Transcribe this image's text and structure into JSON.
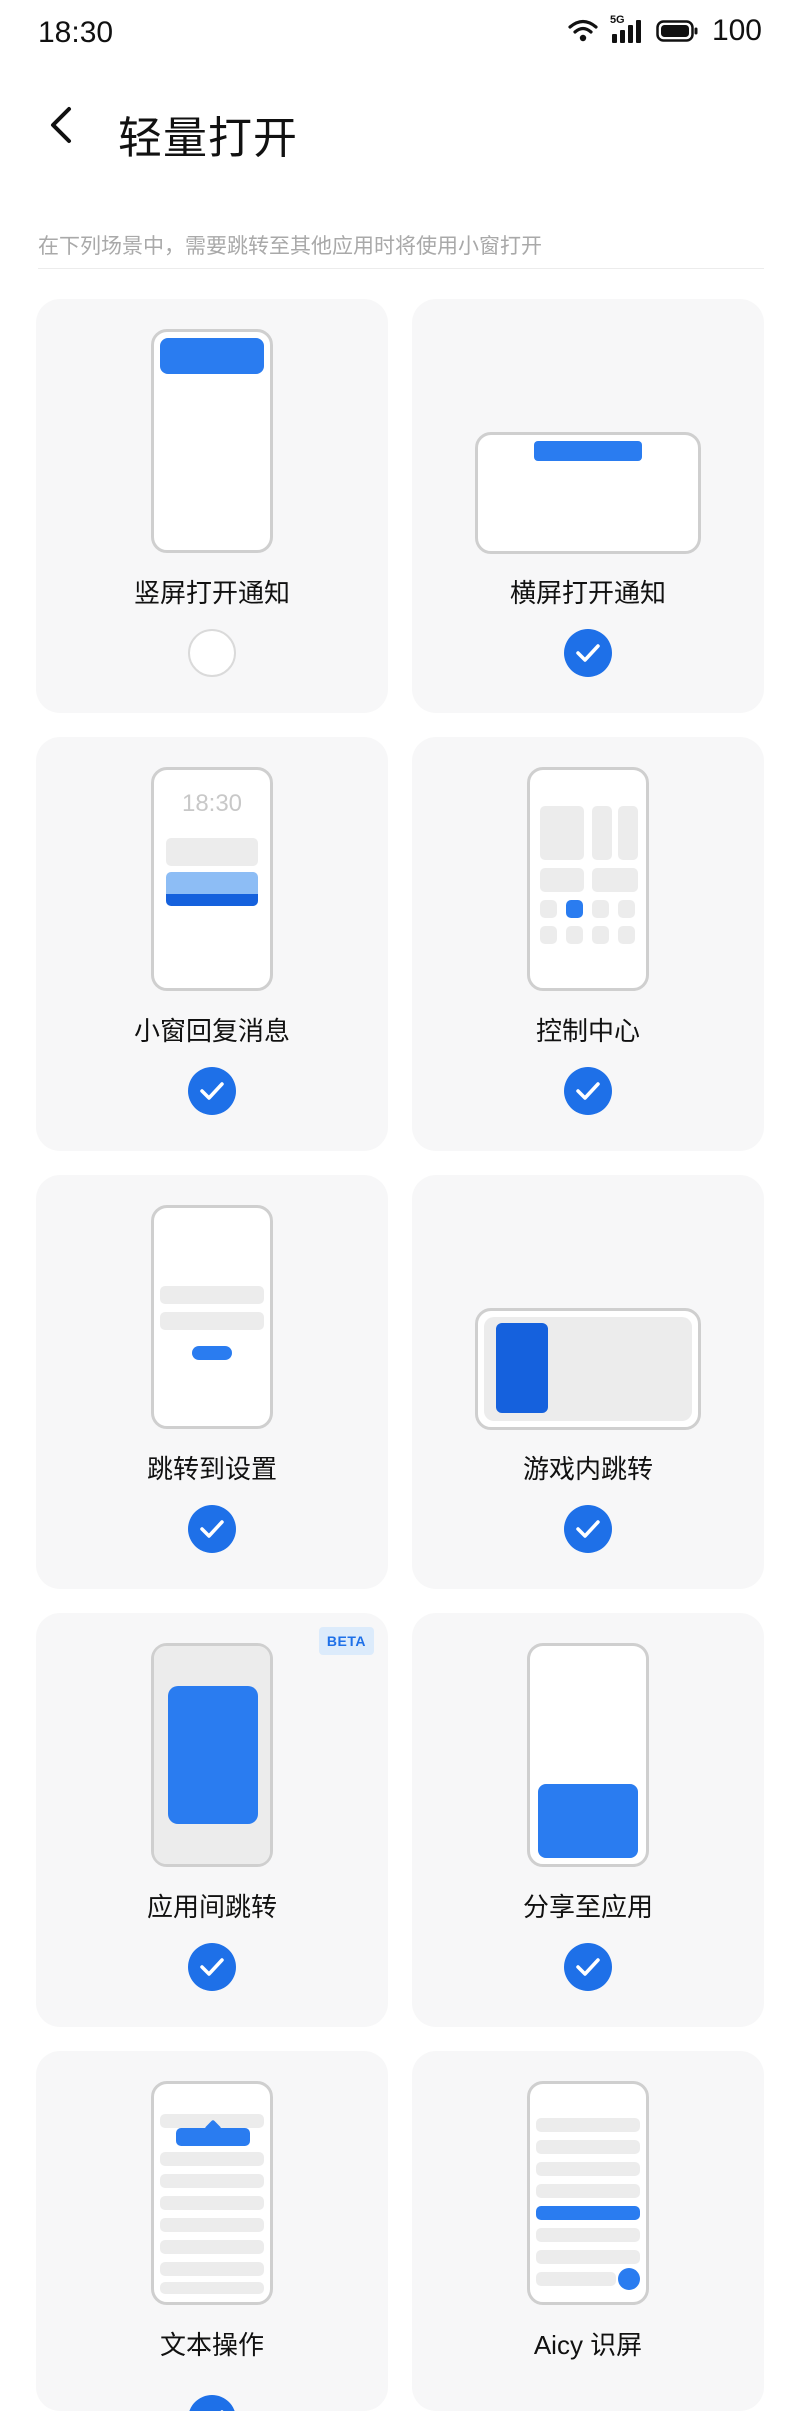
{
  "status_bar": {
    "time": "18:30",
    "network": "5G",
    "battery": "100"
  },
  "header": {
    "title": "轻量打开",
    "back_icon": "chevron-left-icon"
  },
  "description": "在下列场景中，需要跳转至其他应用时将使用小窗打开",
  "colors": {
    "accent": "#1e70e8",
    "card_bg": "#f7f7f8",
    "beta_bg": "#dcebfb"
  },
  "cards": [
    {
      "label": "竖屏打开通知",
      "checked": false
    },
    {
      "label": "横屏打开通知",
      "checked": true
    },
    {
      "label": "小窗回复消息",
      "checked": true,
      "preview_time": "18:30"
    },
    {
      "label": "控制中心",
      "checked": true
    },
    {
      "label": "跳转到设置",
      "checked": true
    },
    {
      "label": "游戏内跳转",
      "checked": true
    },
    {
      "label": "应用间跳转",
      "checked": true,
      "badge": "BETA"
    },
    {
      "label": "分享至应用",
      "checked": true
    },
    {
      "label": "文本操作",
      "checked": true
    },
    {
      "label": "Aicy 识屏",
      "checked": true
    }
  ]
}
